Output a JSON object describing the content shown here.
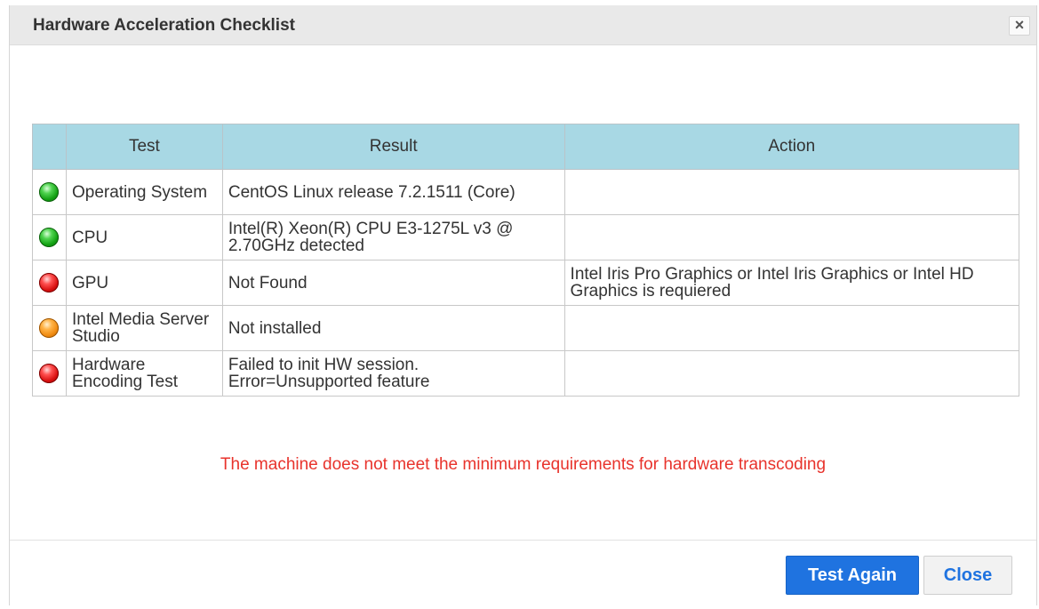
{
  "dialog": {
    "title": "Hardware Acceleration Checklist",
    "close_icon": "×"
  },
  "table": {
    "headers": [
      "",
      "Test",
      "Result",
      "Action"
    ],
    "rows": [
      {
        "status": "green",
        "test": "Operating System",
        "result": "CentOS Linux release 7.2.1511 (Core)",
        "action": ""
      },
      {
        "status": "green",
        "test": "CPU",
        "result": "Intel(R) Xeon(R) CPU E3-1275L v3 @ 2.70GHz detected",
        "action": ""
      },
      {
        "status": "red",
        "test": "GPU",
        "result": "Not Found",
        "action": "Intel Iris Pro Graphics or Intel Iris Graphics or Intel HD Graphics is requiered"
      },
      {
        "status": "orange",
        "test": "Intel Media Server Studio",
        "result": "Not installed",
        "action": ""
      },
      {
        "status": "red",
        "test": "Hardware Encoding Test",
        "result": "Failed to init HW session. Error=Unsupported feature",
        "action": ""
      }
    ]
  },
  "message": "The machine does not meet the minimum requirements for hardware transcoding",
  "buttons": {
    "test_again": "Test Again",
    "close": "Close"
  },
  "colors": {
    "header_bg": "#a8d8e4",
    "warning_text": "#e8332c",
    "primary_button": "#1f73e0",
    "status_green": "#12a012",
    "status_red": "#d81010",
    "status_orange": "#f08a10"
  }
}
